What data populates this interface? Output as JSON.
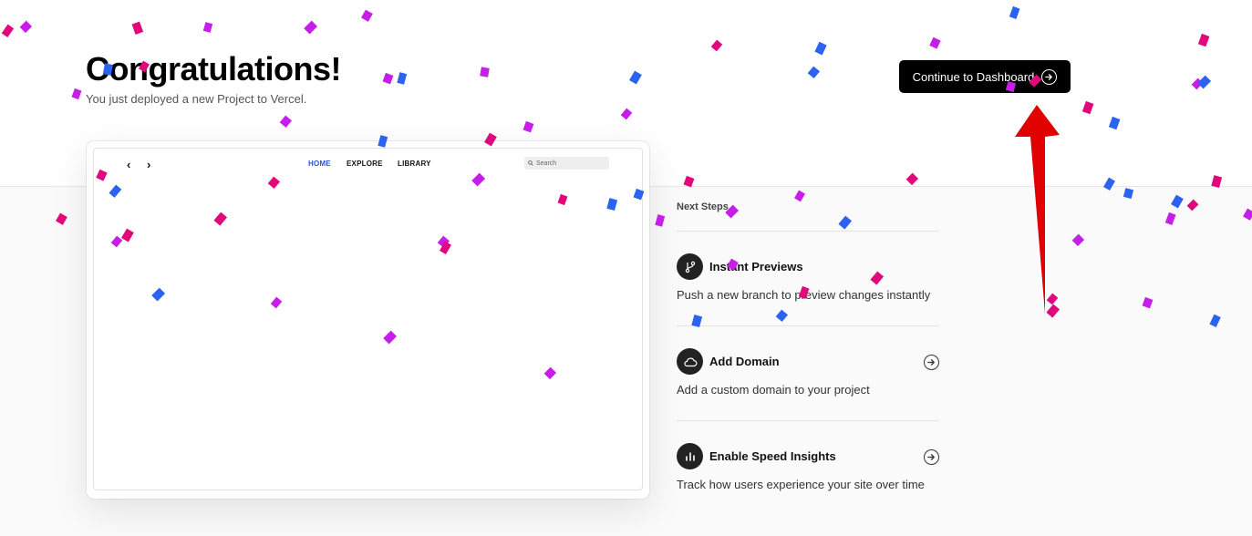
{
  "header": {
    "title": "Congratulations!",
    "subtitle": "You just deployed a new Project to Vercel.",
    "cta_label": "Continue to Dashboard"
  },
  "preview": {
    "nav": [
      "HOME",
      "EXPLORE",
      "LIBRARY"
    ],
    "active": "HOME",
    "search_placeholder": "Search"
  },
  "steps": {
    "heading": "Next Steps",
    "items": [
      {
        "title": "Instant Previews",
        "desc": "Push a new branch to preview changes instantly",
        "icon": "git-branch-icon",
        "has_arrow": false
      },
      {
        "title": "Add Domain",
        "desc": "Add a custom domain to your project",
        "icon": "cloud-icon",
        "has_arrow": true
      },
      {
        "title": "Enable Speed Insights",
        "desc": "Track how users experience your site over time",
        "icon": "bar-chart-icon",
        "has_arrow": true
      }
    ]
  },
  "colors": {
    "confetti": [
      "#e0087a",
      "#c61ee8",
      "#2b63f0"
    ],
    "pointer": "#e00000",
    "accent_link": "#2a52d6"
  }
}
